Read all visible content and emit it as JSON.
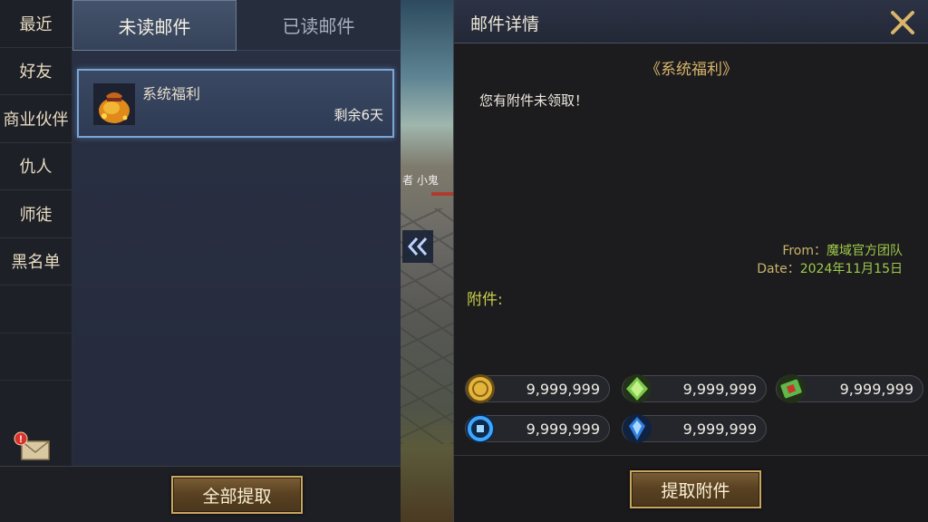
{
  "sidebar": {
    "items": [
      {
        "label": "最近"
      },
      {
        "label": "好友"
      },
      {
        "label": "商业伙伴"
      },
      {
        "label": "仇人"
      },
      {
        "label": "师徒"
      },
      {
        "label": "黑名单"
      }
    ],
    "mail_badge": "!"
  },
  "tabs": [
    {
      "label": "未读邮件",
      "active": true
    },
    {
      "label": "已读邮件",
      "active": false
    }
  ],
  "mail_list": [
    {
      "subject": "系统福利",
      "remaining": "剩余6天",
      "icon": "gold-bag-icon"
    }
  ],
  "list_footer": {
    "claim_all_label": "全部提取"
  },
  "scene": {
    "text": "者  小鬼"
  },
  "detail": {
    "title": "邮件详情",
    "subject": "《系统福利》",
    "body": "您有附件未领取！",
    "from_label": "From：",
    "from_value": "魔域官方团队",
    "date_label": "Date：",
    "date_value": "2024年11月15日",
    "attachments_label": "附件:",
    "attachments": [
      {
        "icon": "gold-coin-icon",
        "amount": "9,999,999"
      },
      {
        "icon": "green-gem-icon",
        "amount": "9,999,999"
      },
      {
        "icon": "green-ticket-icon",
        "amount": "9,999,999"
      },
      {
        "icon": "blue-orb-icon",
        "amount": "9,999,999"
      },
      {
        "icon": "blue-crystal-icon",
        "amount": "9,999,999"
      }
    ],
    "claim_label": "提取附件"
  },
  "colors": {
    "accent_gold": "#c9a660",
    "selected_border": "#7aa6d6",
    "date_value_green": "#9ec94a",
    "attach_label": "#c8cf4a"
  }
}
